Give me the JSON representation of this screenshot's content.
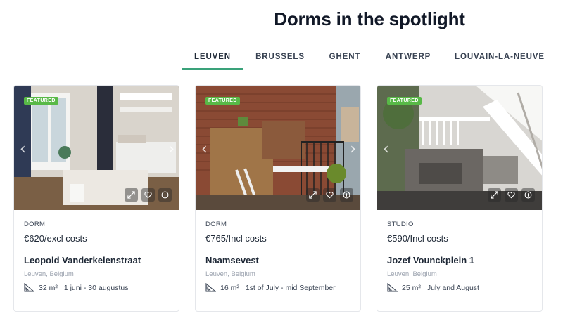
{
  "section": {
    "title": "Dorms in the spotlight"
  },
  "tabs": [
    {
      "label": "LEUVEN",
      "active": true
    },
    {
      "label": "BRUSSELS",
      "active": false
    },
    {
      "label": "GHENT",
      "active": false
    },
    {
      "label": "ANTWERP",
      "active": false
    },
    {
      "label": "LOUVAIN-LA-NEUVE",
      "active": false
    }
  ],
  "accent_color": "#3aa27a",
  "badge_color": "#58b947",
  "cards": [
    {
      "badge": "FEATURED",
      "type": "DORM",
      "price": "€620/excl costs",
      "street": "Leopold Vanderkelenstraat",
      "city": "Leuven, Belgium",
      "area": "32 m²",
      "dates": "1 juni - 30 augustus"
    },
    {
      "badge": "FEATURED",
      "type": "DORM",
      "price": "€765/Incl costs",
      "street": "Naamsevest",
      "city": "Leuven, Belgium",
      "area": "16 m²",
      "dates": "1st of July - mid September"
    },
    {
      "badge": "FEATURED",
      "type": "STUDIO",
      "price": "€590/Incl costs",
      "street": "Jozef Vounckplein 1",
      "city": "Leuven, Belgium",
      "area": "25 m²",
      "dates": "July and August"
    }
  ],
  "icons": {
    "prev": "chevron-left-icon",
    "next": "chevron-right-icon",
    "expand": "expand-icon",
    "favorite": "heart-icon",
    "add": "plus-circle-icon",
    "area": "ruler-triangle-icon"
  }
}
